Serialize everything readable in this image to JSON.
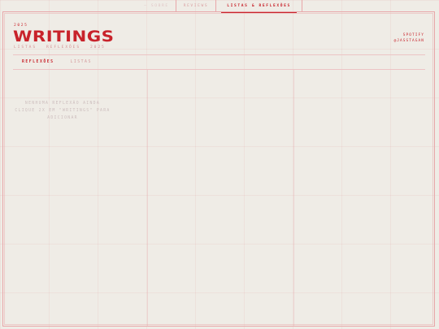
{
  "nav": {
    "items": [
      {
        "label": "— SOBRE",
        "active": false
      },
      {
        "label": "REVIEWS",
        "active": false
      },
      {
        "label": "LISTAS & REFLEXÕES",
        "active": true
      }
    ]
  },
  "header": {
    "kicker": "2025",
    "title": "WRITINGS",
    "subtitle_items": [
      "LISTAS",
      "REFLEXÕES",
      "2025"
    ],
    "side_line1": "SPOTIFY",
    "side_line2": "@JASSTAGAN"
  },
  "tabs": [
    {
      "label": "REFLEXÕES",
      "active": true
    },
    {
      "label": "LISTAS",
      "active": false
    }
  ],
  "empty_state": {
    "line1": "NENHUMA REFLEXÃO AINDA",
    "line2": "CLIQUE 2X EM \"WRITINGS\" PARA",
    "line3": "ADICIONAR"
  },
  "colors": {
    "accent": "#c8232b",
    "background": "#efece6",
    "rule": "#e8a6a9"
  }
}
